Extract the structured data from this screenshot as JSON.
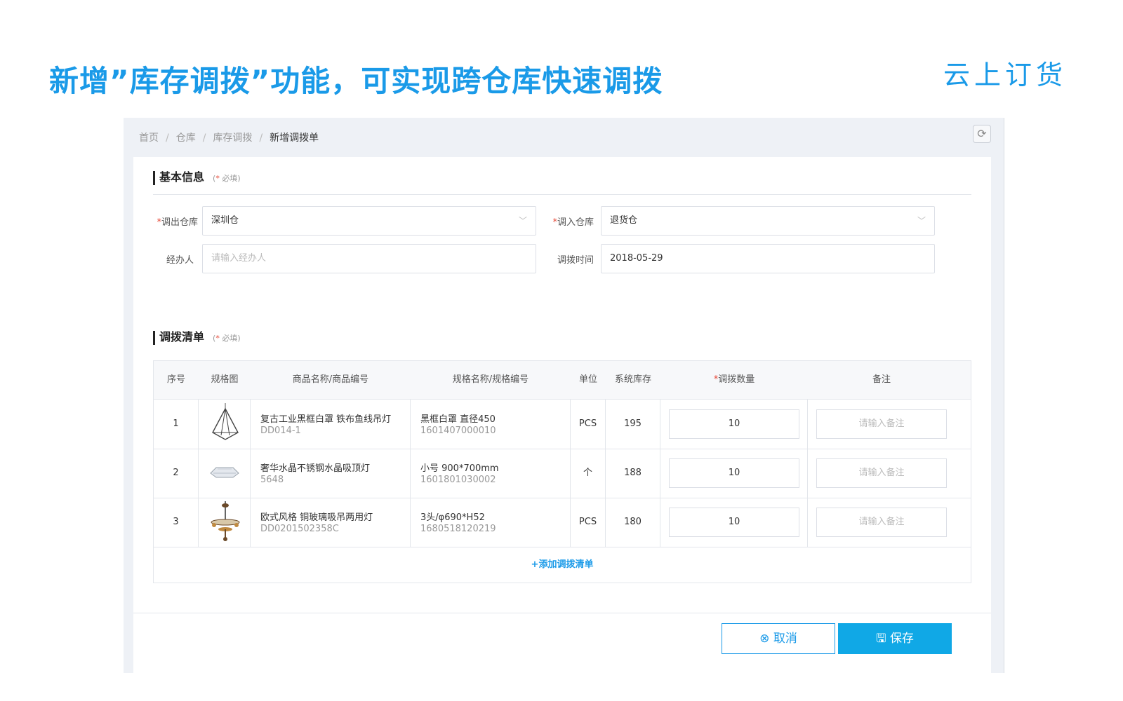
{
  "headline": "新增”库存调拨”功能，可实现跨仓库快速调拨",
  "brand": "云上订货",
  "breadcrumb": {
    "home": "首页",
    "warehouse": "仓库",
    "transfer": "库存调拨",
    "current": "新增调拨单"
  },
  "basic_info": {
    "title": "基本信息",
    "required_note": "必填",
    "out_warehouse": {
      "label": "调出仓库",
      "value": "深圳仓"
    },
    "in_warehouse": {
      "label": "调入仓库",
      "value": "退货仓"
    },
    "handler": {
      "label": "经办人",
      "placeholder": "请输入经办人"
    },
    "transfer_time": {
      "label": "调拨时间",
      "value": "2018-05-29"
    }
  },
  "transfer_list": {
    "title": "调拨清单",
    "required_note": "必填",
    "headers": {
      "index": "序号",
      "image": "规格图",
      "product": "商品名称/商品编号",
      "spec": "规格名称/规格编号",
      "unit": "单位",
      "stock": "系统库存",
      "qty": "调拨数量",
      "note": "备注"
    },
    "rows": [
      {
        "index": "1",
        "name": "复古工业黑框白罩 铁布鱼线吊灯",
        "code": "DD014-1",
        "spec": "黑框白罩 直径450",
        "spec_code": "1601407000010",
        "unit": "PCS",
        "stock": "195",
        "qty": "10",
        "note_placeholder": "请输入备注"
      },
      {
        "index": "2",
        "name": "奢华水晶不锈钢水晶吸顶灯",
        "code": "5648",
        "spec": "小号 900*700mm",
        "spec_code": "1601801030002",
        "unit": "个",
        "stock": "188",
        "qty": "10",
        "note_placeholder": "请输入备注"
      },
      {
        "index": "3",
        "name": "欧式风格 铜玻璃吸吊两用灯",
        "code": "DD0201502358C",
        "spec": "3头/φ690*H52",
        "spec_code": "1680518120219",
        "unit": "PCS",
        "stock": "180",
        "qty": "10",
        "note_placeholder": "请输入备注"
      }
    ],
    "add_label": "+添加调拨清单"
  },
  "actions": {
    "cancel": "取消",
    "save": "保存"
  }
}
